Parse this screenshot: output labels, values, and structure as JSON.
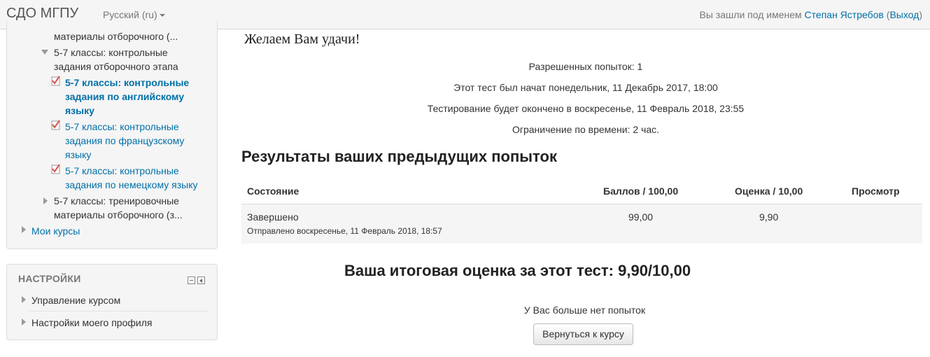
{
  "navbar": {
    "brand": "СДО МГПУ",
    "language": "Русский (ru)",
    "login_prefix": "Вы зашли под именем",
    "user_name": "Степан Ястребов",
    "logout_open": "(",
    "logout_label": "Выход",
    "logout_close": ")"
  },
  "navigation": {
    "items": [
      {
        "label": "материалы отборочного (...",
        "type": "text"
      },
      {
        "label_line1": "5-7 классы: контрольные",
        "label_line2": "задания отборочного этапа",
        "type": "section-open"
      },
      {
        "label_line1": "5-7 классы: контрольные",
        "label_line2": "задания по английскому",
        "label_line3": "языку",
        "type": "quiz-active"
      },
      {
        "label_line1": "5-7 классы: контрольные",
        "label_line2": "задания по французскому",
        "label_line3": "языку",
        "type": "quiz"
      },
      {
        "label_line1": "5-7 классы: контрольные",
        "label_line2": "задания по немецкому языку",
        "type": "quiz"
      },
      {
        "label_line1": "5-7 классы: тренировочные",
        "label_line2": "материалы отборочного (з...",
        "type": "section-closed"
      },
      {
        "label": "Мои курсы",
        "type": "link"
      }
    ]
  },
  "settings": {
    "title": "НАСТРОЙКИ",
    "items": [
      {
        "label": "Управление курсом"
      },
      {
        "label": "Настройки моего профиля"
      }
    ]
  },
  "quiz": {
    "wish": "Желаем Вам удачи!",
    "info": [
      "Разрешенных попыток: 1",
      "Этот тест был начат понедельник, 11 Декабрь 2017, 18:00",
      "Тестирование будет окончено в воскресенье, 11 Февраль 2018, 23:55",
      "Ограничение по времени: 2 час."
    ],
    "results_heading": "Результаты ваших предыдущих попыток",
    "table": {
      "headers": [
        "Состояние",
        "Баллов / 100,00",
        "Оценка / 10,00",
        "Просмотр"
      ],
      "rows": [
        {
          "status": "Завершено",
          "submitted": "Отправлено воскресенье, 11 Февраль 2018, 18:57",
          "score": "99,00",
          "grade": "9,90",
          "review": ""
        }
      ]
    },
    "final_grade": "Ваша итоговая оценка за этот тест: 9,90/10,00",
    "no_more_attempts": "У Вас больше нет попыток",
    "back_button": "Вернуться к курсу"
  },
  "colors": {
    "link": "#0070a8",
    "quiz_check": "#d9534f",
    "navbar_bg": "#f5f5f5"
  }
}
